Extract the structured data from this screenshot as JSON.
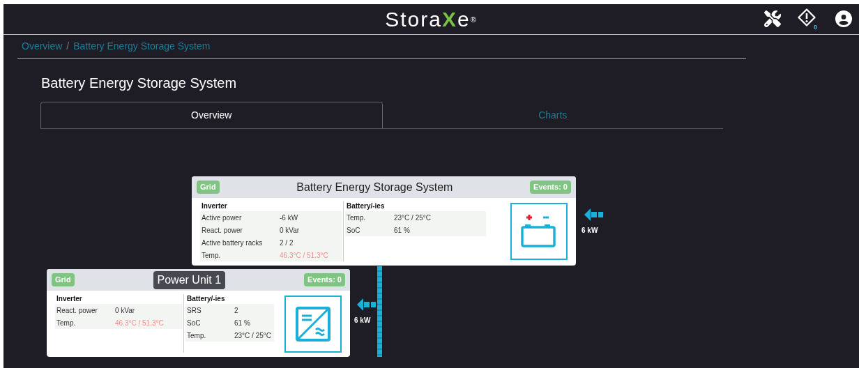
{
  "header": {
    "logo": {
      "before": "Stora",
      "accent": "X",
      "after": "e",
      "mark": "®"
    },
    "alert_count": "0"
  },
  "breadcrumb": [
    "Overview",
    "Battery Energy Storage System"
  ],
  "breadcrumb_separator": "/",
  "title": "Battery Energy Storage System",
  "tabs": [
    {
      "label": "Overview",
      "selected": true
    },
    {
      "label": "Charts",
      "selected": false
    }
  ],
  "nodes": [
    {
      "kind": "battery",
      "badge": "Grid",
      "title": "Battery Energy Storage System",
      "highlighted": false,
      "events": "Events: 0",
      "flow": "6 kW",
      "sections": [
        {
          "heading": "Inverter",
          "rows": [
            {
              "label": "Active power",
              "value": "-6 kW",
              "alert": false
            },
            {
              "label": "React. power",
              "value": "0 kVar",
              "alert": false
            },
            {
              "label": "Active battery racks",
              "value": "2 / 2",
              "alert": false
            },
            {
              "label": "Temp.",
              "value": "46.3°C / 51.3°C",
              "alert": true
            }
          ]
        },
        {
          "heading": "Battery/-ies",
          "rows": [
            {
              "label": "Temp.",
              "value": "23°C / 25°C",
              "alert": false
            },
            {
              "label": "SoC",
              "value": "61 %",
              "alert": false
            }
          ]
        }
      ]
    },
    {
      "kind": "inverter",
      "badge": "Grid",
      "title": "Power Unit 1",
      "highlighted": true,
      "events": "Events: 0",
      "flow": "6 kW",
      "sections": [
        {
          "heading": "Inverter",
          "rows": [
            {
              "label": "React. power",
              "value": "0 kVar",
              "alert": false
            },
            {
              "label": "Temp.",
              "value": "46.3°C / 51.3°C",
              "alert": true
            }
          ]
        },
        {
          "heading": "Battery/-ies",
          "rows": [
            {
              "label": "SRS",
              "value": "2",
              "alert": false
            },
            {
              "label": "SoC",
              "value": "61 %",
              "alert": false
            },
            {
              "label": "Temp.",
              "value": "23°C / 25°C",
              "alert": false
            }
          ]
        }
      ]
    }
  ]
}
